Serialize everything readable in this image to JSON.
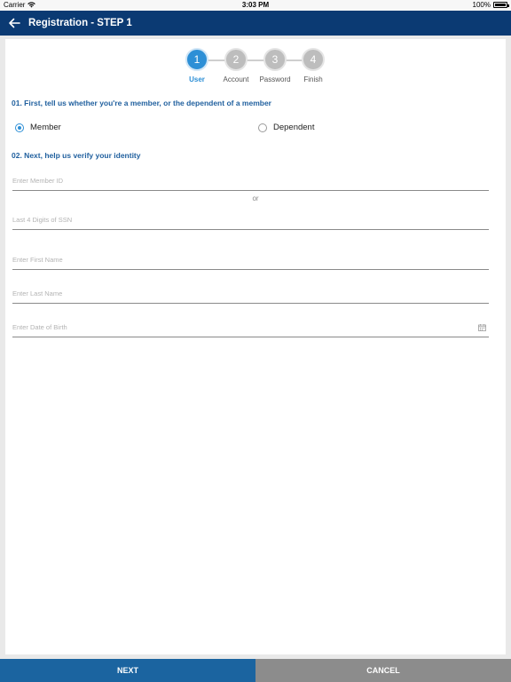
{
  "status_bar": {
    "carrier": "Carrier",
    "time": "3:03 PM",
    "battery": "100%"
  },
  "header": {
    "back_icon": "arrow-left-icon",
    "title": "Registration - STEP 1"
  },
  "stepper": {
    "current": 1,
    "steps": [
      {
        "number": "1",
        "label": "User"
      },
      {
        "number": "2",
        "label": "Account"
      },
      {
        "number": "3",
        "label": "Password"
      },
      {
        "number": "4",
        "label": "Finish"
      }
    ]
  },
  "section1": {
    "title": "01. First, tell us whether you're a member, or the dependent of a member",
    "options": [
      {
        "label": "Member",
        "checked": true
      },
      {
        "label": "Dependent",
        "checked": false
      }
    ]
  },
  "section2": {
    "title": "02. Next, help us verify your identity",
    "member_id_placeholder": "Enter Member ID",
    "or_text": "or",
    "ssn_placeholder": "Last 4 Digits of SSN",
    "first_name_placeholder": "Enter First Name",
    "last_name_placeholder": "Enter Last Name",
    "dob_placeholder": "Enter Date of Birth",
    "dob_icon": "calendar-icon"
  },
  "footer": {
    "next_label": "NEXT",
    "cancel_label": "CANCEL"
  },
  "colors": {
    "header": "#0b3a73",
    "accent": "#2d8fd6",
    "title_text": "#1f5f9e",
    "next_button": "#1b64a0",
    "cancel_button": "#8c8c8c"
  }
}
